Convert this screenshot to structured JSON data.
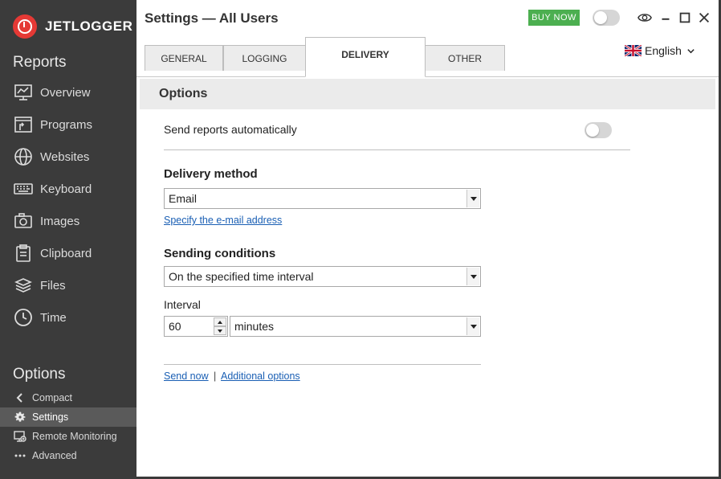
{
  "app": {
    "logo_text": "JETLOGGER"
  },
  "sidebar": {
    "reports_title": "Reports",
    "reports": [
      {
        "label": "Overview",
        "icon": "overview-icon"
      },
      {
        "label": "Programs",
        "icon": "programs-icon"
      },
      {
        "label": "Websites",
        "icon": "websites-icon"
      },
      {
        "label": "Keyboard",
        "icon": "keyboard-icon"
      },
      {
        "label": "Images",
        "icon": "camera-icon"
      },
      {
        "label": "Clipboard",
        "icon": "clipboard-icon"
      },
      {
        "label": "Files",
        "icon": "files-icon"
      },
      {
        "label": "Time",
        "icon": "clock-icon"
      }
    ],
    "options_title": "Options",
    "options": [
      {
        "label": "Compact",
        "icon": "chevron-left-icon"
      },
      {
        "label": "Settings",
        "icon": "gear-icon",
        "active": true
      },
      {
        "label": "Remote Monitoring",
        "icon": "remote-monitoring-icon"
      },
      {
        "label": "Advanced",
        "icon": "more-dots-icon"
      }
    ]
  },
  "header": {
    "title": "Settings — All Users",
    "buy_now": "BUY NOW"
  },
  "tabs": [
    {
      "label": "GENERAL"
    },
    {
      "label": "LOGGING"
    },
    {
      "label": "DELIVERY",
      "active": true
    },
    {
      "label": "OTHER"
    }
  ],
  "language": {
    "label": "English"
  },
  "options": {
    "header": "Options",
    "send_reports_label": "Send reports automatically",
    "send_reports_enabled": false,
    "delivery_method_title": "Delivery method",
    "delivery_method_value": "Email",
    "specify_email_link": "Specify the e-mail address",
    "sending_conditions_title": "Sending conditions",
    "sending_conditions_value": "On the specified time interval",
    "interval_label": "Interval",
    "interval_value": "60",
    "interval_unit": "minutes",
    "send_now_link": "Send now",
    "link_separator": "|",
    "additional_options_link": "Additional options"
  },
  "colors": {
    "sidebar_bg": "#3b3b3b",
    "accent_red": "#e53935",
    "buy_now_green": "#4caf50",
    "link_blue": "#1a5fb4"
  }
}
